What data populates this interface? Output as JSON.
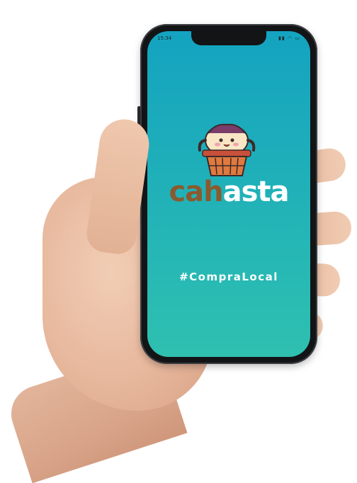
{
  "status_bar": {
    "time": "15:34",
    "icons": "▮▮ ◠ ▭"
  },
  "brand": {
    "part_a": "cah",
    "part_b": "asta"
  },
  "tagline": "#CompraLocal",
  "colors": {
    "screen_top": "#14a3c0",
    "screen_bottom": "#2fc0b0",
    "brand_brown": "#8a5a2f",
    "basket": "#c9503a"
  },
  "icons": {
    "logo": "laundry-basket-mascot-icon"
  }
}
